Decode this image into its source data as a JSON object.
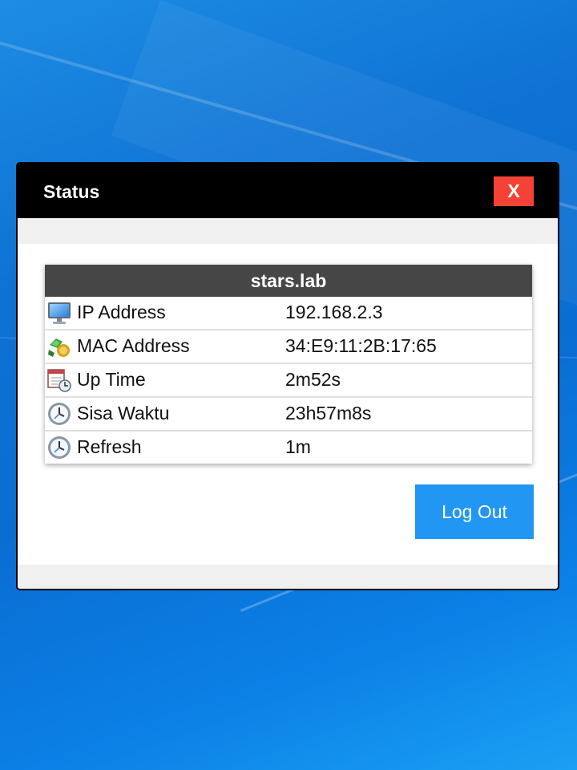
{
  "dialog": {
    "title": "Status",
    "close_label": "X"
  },
  "table": {
    "header": "stars.lab",
    "rows": [
      {
        "label": "IP Address",
        "value": "192.168.2.3",
        "icon": "computer-monitor-icon"
      },
      {
        "label": "MAC Address",
        "value": "34:E9:11:2B:17:65",
        "icon": "network-card-icon"
      },
      {
        "label": "Up Time",
        "value": "2m52s",
        "icon": "calendar-clock-icon"
      },
      {
        "label": "Sisa Waktu",
        "value": "23h57m8s",
        "icon": "clock-icon"
      },
      {
        "label": "Refresh",
        "value": "1m",
        "icon": "clock-icon"
      }
    ]
  },
  "actions": {
    "logout_label": "Log Out"
  },
  "colors": {
    "titlebar": "#000000",
    "close_button": "#f44336",
    "table_header": "#464646",
    "logout_button": "#2196f3"
  }
}
